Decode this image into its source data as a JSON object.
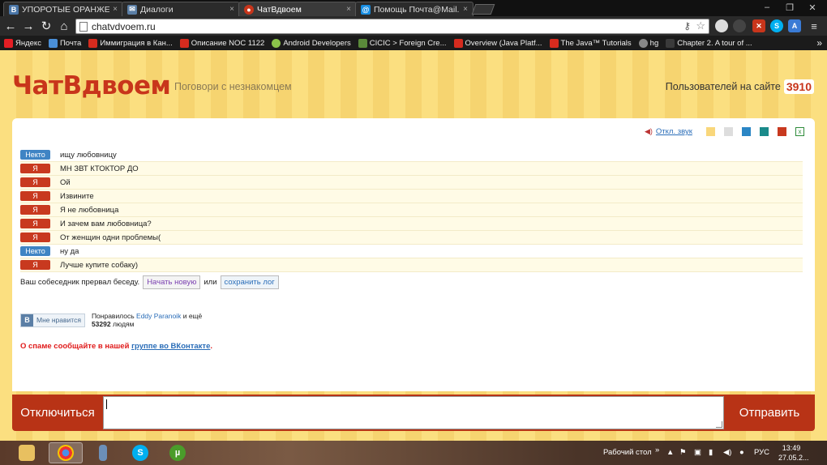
{
  "browser": {
    "tabs": [
      {
        "title": "УПОРОТЫЕ ОРАНЖЕВЫЕ",
        "icon": "vk-icon",
        "color": "#4a76a8",
        "glyph": "В"
      },
      {
        "title": "Диалоги",
        "icon": "chat-icon",
        "color": "#5b7fa6",
        "glyph": "✉"
      },
      {
        "title": "ЧатВдвоем",
        "icon": "chatvdvoem-icon",
        "color": "#c8351b",
        "glyph": "●"
      },
      {
        "title": "Помощь Почта@Mail.Ru",
        "icon": "mailru-icon",
        "color": "#168de2",
        "glyph": "@"
      }
    ],
    "url": "chatvdvoem.ru",
    "bookmarks": [
      {
        "label": "Яндекс",
        "color": "#e31e24"
      },
      {
        "label": "Почта",
        "color": "#4a8fd8"
      },
      {
        "label": "Иммиграция в Кан...",
        "color": "#d52b1e"
      },
      {
        "label": "Описание NOC 1122",
        "color": "#d52b1e"
      },
      {
        "label": "Android Developers",
        "color": "#8bc34a"
      },
      {
        "label": "CICIC > Foreign Cre...",
        "color": "#5a8a3a"
      },
      {
        "label": "Overview (Java Platf...",
        "color": "#d52b1e"
      },
      {
        "label": "The Java™ Tutorials",
        "color": "#d52b1e"
      },
      {
        "label": "hg",
        "color": "#888888"
      },
      {
        "label": "Chapter 2. A tour of ...",
        "color": "#3a3a3a"
      }
    ],
    "bookmarks_more": "»"
  },
  "site": {
    "logo": "ЧатВдвоем",
    "tagline": "Поговори с незнакомцем",
    "users_label": "Пользователей на сайте",
    "users_count": "3910",
    "sound_toggle": "Откл. звук",
    "theme_colors": [
      "#f9d77b",
      "#dddddd",
      "#2b86c5",
      "#1a8a8a",
      "#c8391f"
    ],
    "stranger_label": "Некто",
    "me_label": "Я",
    "messages": [
      {
        "from": "stranger",
        "text": "ищу любовницу"
      },
      {
        "from": "me",
        "text": "МН ЗВТ КТОКТОР ДО"
      },
      {
        "from": "me",
        "text": "Ой"
      },
      {
        "from": "me",
        "text": "Извините"
      },
      {
        "from": "me",
        "text": "Я не любовница"
      },
      {
        "from": "me",
        "text": "И зачем вам любовница?"
      },
      {
        "from": "me",
        "text": "От женщин одни проблемы("
      },
      {
        "from": "stranger",
        "text": "ну да"
      },
      {
        "from": "me",
        "text": "Лучше купите собаку)"
      }
    ],
    "ended_text": "Ваш собеседник прервал беседу.",
    "start_new_label": "Начать новую",
    "or_text": "или",
    "save_log_label": "сохранить лог",
    "vk_like": {
      "logo": "B",
      "button_label": "Мне нравится",
      "liked_prefix": "Понравилось",
      "liked_user": "Eddy Paranoik",
      "liked_suffix": "и ещё",
      "count": "53292",
      "count_suffix": "людям"
    },
    "spam_text": "О спаме сообщайте в нашей",
    "spam_link": "группе во ВКонтакте",
    "spam_end": ".",
    "disconnect_label": "Отключиться",
    "send_label": "Отправить",
    "message_input_value": ""
  },
  "taskbar": {
    "desktop_label": "Рабочий стол",
    "desktop_arrow": "»",
    "language": "РУС",
    "time": "13:49",
    "date": "27.05.2..."
  }
}
